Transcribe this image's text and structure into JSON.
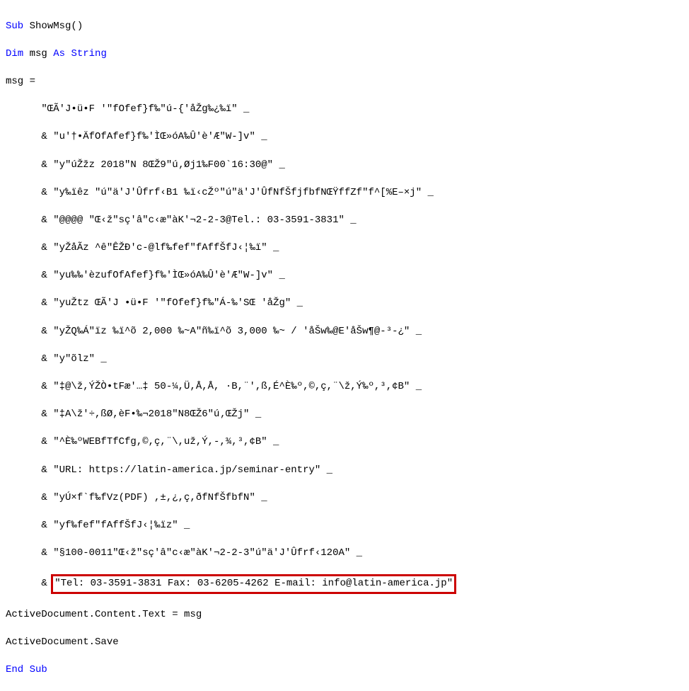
{
  "code": {
    "line1_kw1": "Sub",
    "line1_text": " ShowMsg()",
    "line2_kw1": "Dim",
    "line2_text1": " msg ",
    "line2_kw2": "As String",
    "line3": "msg =",
    "line4": "      \"ŒÃ'J•ü•F '\"fOfef}f‰\"ú-{'åŽg‰¿‰ï\" _",
    "line5": "      & \"u'†•ÄfOfAfef}f‰'ÌŒ»óA‰Û'è'Æ\"W-]v\" _",
    "line6": "      & \"y\"úŽžz 2018\"N 8ŒŽ9\"ú‚Øj1‰F00`16:30@\" _",
    "line7": "      & \"y‰ïêz \"ú\"ä'J'Ûfrf‹B1 ‰ï‹cŽº\"ú\"ä'J'ÛfNfŠfjfbfNŒŸffZf\"f^[%E–×j\" _",
    "line8": "      & \"@@@@ \"Œ‹ž\"sç'â\"c‹æ\"àK'¬2-2-3@Tel.: 03-3591-3831\" _",
    "line9": "      & \"yŽåÃz ^ê\"ÊŽÐ'c-@lf‰fef\"fAffŠfJ‹¦‰ï\" _",
    "line10": "      & \"yu‰‰'èzufOfAfef}f‰'ÌŒ»óA‰Û'è'Æ\"W-]v\" _",
    "line11": "      & \"yuŽtz ŒÃ'J •ü•F '\"fOfef}f‰\"Á-‰'SŒ 'åŽg\" _",
    "line12": "      & \"yŽQ‰Á\"ïz ‰ï^õ 2,000 ‰~A\"ñ‰ï^õ 3,000 ‰~ / 'åŠw‰@E'åŠw¶@-³-¿\" _",
    "line13": "      & \"y\"õlz\" _",
    "line14": "      & \"‡@\\ž,ÝŽÒ•tFæ'…‡ 50-¼,Ü,Å,Å, ·B,¨',ß,É^È‰º,©,ç,¨\\ž,Ý‰º,³,¢B\" _",
    "line15": "      & \"‡A\\ž'÷,ßØ,èF•‰¬2018\"N8ŒŽ6\"ú‚ŒŽj\" _",
    "line16": "      & \"^È‰ºWEBfTfCfg,©,ç,¨\\,už,Ý,-,¾,³,¢B\" _",
    "line17": "      & \"URL: https://latin-america.jp/seminar-entry\" _",
    "line18": "      & \"yÚ×f`f‰fVz(PDF) ,±,¿,ç,ðfNfŠfbfN\" _",
    "line19": "      & \"yf‰fef\"fAffŠfJ‹¦‰ïz\" _",
    "line20": "      & \"§100-0011\"Œ‹ž\"sç'â\"c‹æ\"àK'¬2-2-3\"ú\"ä'J'Ûfrf‹120A\" _",
    "line21_pre": "      & ",
    "line21_highlighted": "\"Tel: 03-3591-3831 Fax: 03-6205-4262 E-mail: info@latin-america.jp\"",
    "line22": "ActiveDocument.Content.Text = msg",
    "line23": "ActiveDocument.Save",
    "line24_kw": "End Sub"
  }
}
